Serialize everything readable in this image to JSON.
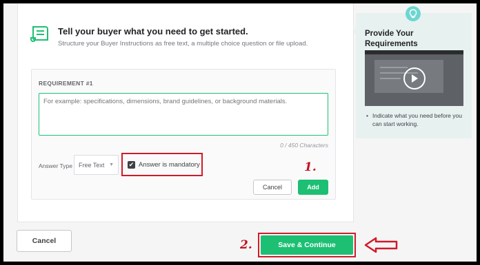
{
  "main": {
    "title": "Tell your buyer what you need to get started.",
    "subtitle": "Structure your Buyer Instructions as free text, a multiple choice question or file upload.",
    "requirement": {
      "label": "REQUIREMENT #1",
      "placeholder": "For example: specifications, dimensions, brand guidelines, or background materials.",
      "char_count": "0 / 450 Characters",
      "answer_type_label": "Answer Type",
      "answer_type_value": "Free Text",
      "mandatory_label": "Answer is mandatory",
      "mandatory_checked": true,
      "cancel_label": "Cancel",
      "add_label": "Add"
    }
  },
  "side": {
    "title": "Provide Your Requirements",
    "bullet": "Indicate what you need before you can start working."
  },
  "footer": {
    "cancel_label": "Cancel",
    "save_label": "Save & Continue"
  },
  "annotations": {
    "one": "1.",
    "two": "2."
  },
  "icons": {
    "document": "scroll-icon",
    "bulb": "lightbulb-icon",
    "play": "play-icon",
    "check": "checkmark-icon",
    "arrow": "left-arrow-icon"
  },
  "colors": {
    "brand_green": "#1dbf73",
    "annotation_red": "#d01a28",
    "side_bg": "#e7f1f0"
  }
}
